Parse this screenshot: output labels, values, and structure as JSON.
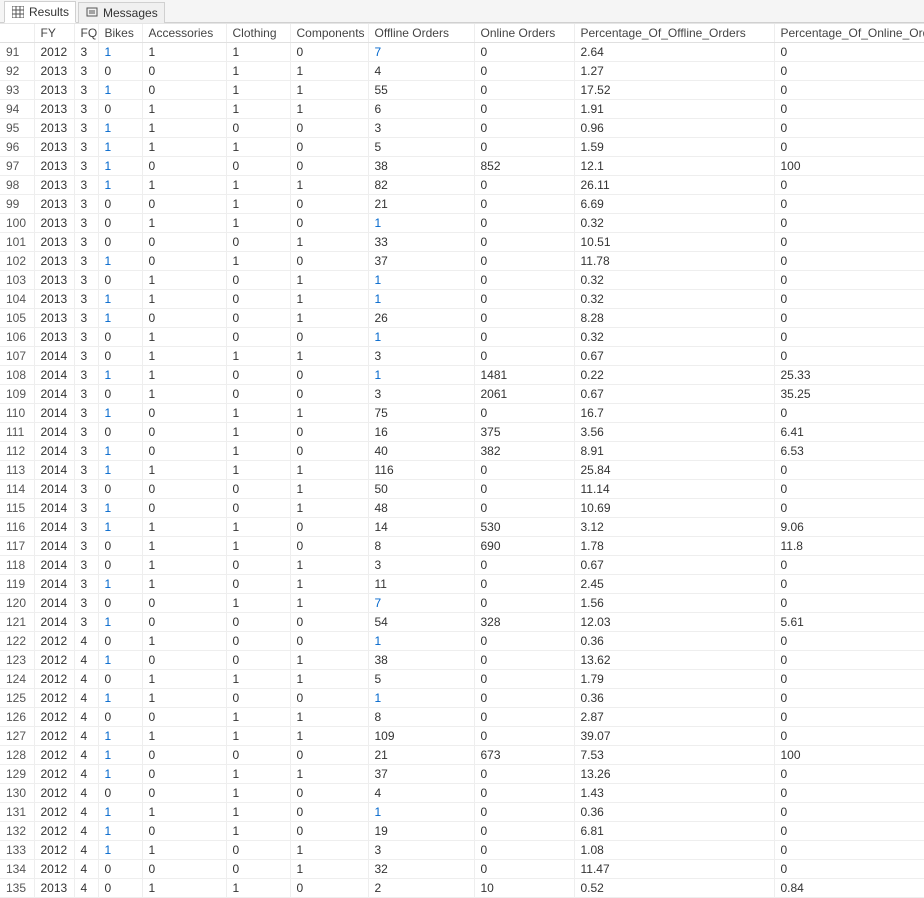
{
  "tabs": {
    "results": "Results",
    "messages": "Messages"
  },
  "columns": [
    "",
    "FY",
    "FQ",
    "Bikes",
    "Accessories",
    "Clothing",
    "Components",
    "Offline Orders",
    "Online Orders",
    "Percentage_Of_Offline_Orders",
    "Percentage_Of_Online_Orders"
  ],
  "link_columns": {
    "3": true,
    "7": true
  },
  "rows": [
    {
      "n": "91",
      "FY": "2012",
      "FQ": "3",
      "Bikes": "1",
      "Accessories": "1",
      "Clothing": "1",
      "Components": "0",
      "Offline": "7",
      "Online": "0",
      "PctOff": "2.64",
      "PctOn": "0"
    },
    {
      "n": "92",
      "FY": "2013",
      "FQ": "3",
      "Bikes": "0",
      "Accessories": "0",
      "Clothing": "1",
      "Components": "1",
      "Offline": "4",
      "Online": "0",
      "PctOff": "1.27",
      "PctOn": "0"
    },
    {
      "n": "93",
      "FY": "2013",
      "FQ": "3",
      "Bikes": "1",
      "Accessories": "0",
      "Clothing": "1",
      "Components": "1",
      "Offline": "55",
      "Online": "0",
      "PctOff": "17.52",
      "PctOn": "0"
    },
    {
      "n": "94",
      "FY": "2013",
      "FQ": "3",
      "Bikes": "0",
      "Accessories": "1",
      "Clothing": "1",
      "Components": "1",
      "Offline": "6",
      "Online": "0",
      "PctOff": "1.91",
      "PctOn": "0"
    },
    {
      "n": "95",
      "FY": "2013",
      "FQ": "3",
      "Bikes": "1",
      "Accessories": "1",
      "Clothing": "0",
      "Components": "0",
      "Offline": "3",
      "Online": "0",
      "PctOff": "0.96",
      "PctOn": "0"
    },
    {
      "n": "96",
      "FY": "2013",
      "FQ": "3",
      "Bikes": "1",
      "Accessories": "1",
      "Clothing": "1",
      "Components": "0",
      "Offline": "5",
      "Online": "0",
      "PctOff": "1.59",
      "PctOn": "0"
    },
    {
      "n": "97",
      "FY": "2013",
      "FQ": "3",
      "Bikes": "1",
      "Accessories": "0",
      "Clothing": "0",
      "Components": "0",
      "Offline": "38",
      "Online": "852",
      "PctOff": "12.1",
      "PctOn": "100"
    },
    {
      "n": "98",
      "FY": "2013",
      "FQ": "3",
      "Bikes": "1",
      "Accessories": "1",
      "Clothing": "1",
      "Components": "1",
      "Offline": "82",
      "Online": "0",
      "PctOff": "26.11",
      "PctOn": "0"
    },
    {
      "n": "99",
      "FY": "2013",
      "FQ": "3",
      "Bikes": "0",
      "Accessories": "0",
      "Clothing": "1",
      "Components": "0",
      "Offline": "21",
      "Online": "0",
      "PctOff": "6.69",
      "PctOn": "0"
    },
    {
      "n": "100",
      "FY": "2013",
      "FQ": "3",
      "Bikes": "0",
      "Accessories": "1",
      "Clothing": "1",
      "Components": "0",
      "Offline": "1",
      "Online": "0",
      "PctOff": "0.32",
      "PctOn": "0"
    },
    {
      "n": "101",
      "FY": "2013",
      "FQ": "3",
      "Bikes": "0",
      "Accessories": "0",
      "Clothing": "0",
      "Components": "1",
      "Offline": "33",
      "Online": "0",
      "PctOff": "10.51",
      "PctOn": "0"
    },
    {
      "n": "102",
      "FY": "2013",
      "FQ": "3",
      "Bikes": "1",
      "Accessories": "0",
      "Clothing": "1",
      "Components": "0",
      "Offline": "37",
      "Online": "0",
      "PctOff": "11.78",
      "PctOn": "0"
    },
    {
      "n": "103",
      "FY": "2013",
      "FQ": "3",
      "Bikes": "0",
      "Accessories": "1",
      "Clothing": "0",
      "Components": "1",
      "Offline": "1",
      "Online": "0",
      "PctOff": "0.32",
      "PctOn": "0"
    },
    {
      "n": "104",
      "FY": "2013",
      "FQ": "3",
      "Bikes": "1",
      "Accessories": "1",
      "Clothing": "0",
      "Components": "1",
      "Offline": "1",
      "Online": "0",
      "PctOff": "0.32",
      "PctOn": "0"
    },
    {
      "n": "105",
      "FY": "2013",
      "FQ": "3",
      "Bikes": "1",
      "Accessories": "0",
      "Clothing": "0",
      "Components": "1",
      "Offline": "26",
      "Online": "0",
      "PctOff": "8.28",
      "PctOn": "0"
    },
    {
      "n": "106",
      "FY": "2013",
      "FQ": "3",
      "Bikes": "0",
      "Accessories": "1",
      "Clothing": "0",
      "Components": "0",
      "Offline": "1",
      "Online": "0",
      "PctOff": "0.32",
      "PctOn": "0"
    },
    {
      "n": "107",
      "FY": "2014",
      "FQ": "3",
      "Bikes": "0",
      "Accessories": "1",
      "Clothing": "1",
      "Components": "1",
      "Offline": "3",
      "Online": "0",
      "PctOff": "0.67",
      "PctOn": "0"
    },
    {
      "n": "108",
      "FY": "2014",
      "FQ": "3",
      "Bikes": "1",
      "Accessories": "1",
      "Clothing": "0",
      "Components": "0",
      "Offline": "1",
      "Online": "1481",
      "PctOff": "0.22",
      "PctOn": "25.33"
    },
    {
      "n": "109",
      "FY": "2014",
      "FQ": "3",
      "Bikes": "0",
      "Accessories": "1",
      "Clothing": "0",
      "Components": "0",
      "Offline": "3",
      "Online": "2061",
      "PctOff": "0.67",
      "PctOn": "35.25"
    },
    {
      "n": "110",
      "FY": "2014",
      "FQ": "3",
      "Bikes": "1",
      "Accessories": "0",
      "Clothing": "1",
      "Components": "1",
      "Offline": "75",
      "Online": "0",
      "PctOff": "16.7",
      "PctOn": "0"
    },
    {
      "n": "111",
      "FY": "2014",
      "FQ": "3",
      "Bikes": "0",
      "Accessories": "0",
      "Clothing": "1",
      "Components": "0",
      "Offline": "16",
      "Online": "375",
      "PctOff": "3.56",
      "PctOn": "6.41"
    },
    {
      "n": "112",
      "FY": "2014",
      "FQ": "3",
      "Bikes": "1",
      "Accessories": "0",
      "Clothing": "1",
      "Components": "0",
      "Offline": "40",
      "Online": "382",
      "PctOff": "8.91",
      "PctOn": "6.53"
    },
    {
      "n": "113",
      "FY": "2014",
      "FQ": "3",
      "Bikes": "1",
      "Accessories": "1",
      "Clothing": "1",
      "Components": "1",
      "Offline": "116",
      "Online": "0",
      "PctOff": "25.84",
      "PctOn": "0"
    },
    {
      "n": "114",
      "FY": "2014",
      "FQ": "3",
      "Bikes": "0",
      "Accessories": "0",
      "Clothing": "0",
      "Components": "1",
      "Offline": "50",
      "Online": "0",
      "PctOff": "11.14",
      "PctOn": "0"
    },
    {
      "n": "115",
      "FY": "2014",
      "FQ": "3",
      "Bikes": "1",
      "Accessories": "0",
      "Clothing": "0",
      "Components": "1",
      "Offline": "48",
      "Online": "0",
      "PctOff": "10.69",
      "PctOn": "0"
    },
    {
      "n": "116",
      "FY": "2014",
      "FQ": "3",
      "Bikes": "1",
      "Accessories": "1",
      "Clothing": "1",
      "Components": "0",
      "Offline": "14",
      "Online": "530",
      "PctOff": "3.12",
      "PctOn": "9.06"
    },
    {
      "n": "117",
      "FY": "2014",
      "FQ": "3",
      "Bikes": "0",
      "Accessories": "1",
      "Clothing": "1",
      "Components": "0",
      "Offline": "8",
      "Online": "690",
      "PctOff": "1.78",
      "PctOn": "11.8"
    },
    {
      "n": "118",
      "FY": "2014",
      "FQ": "3",
      "Bikes": "0",
      "Accessories": "1",
      "Clothing": "0",
      "Components": "1",
      "Offline": "3",
      "Online": "0",
      "PctOff": "0.67",
      "PctOn": "0"
    },
    {
      "n": "119",
      "FY": "2014",
      "FQ": "3",
      "Bikes": "1",
      "Accessories": "1",
      "Clothing": "0",
      "Components": "1",
      "Offline": "11",
      "Online": "0",
      "PctOff": "2.45",
      "PctOn": "0"
    },
    {
      "n": "120",
      "FY": "2014",
      "FQ": "3",
      "Bikes": "0",
      "Accessories": "0",
      "Clothing": "1",
      "Components": "1",
      "Offline": "7",
      "Online": "0",
      "PctOff": "1.56",
      "PctOn": "0"
    },
    {
      "n": "121",
      "FY": "2014",
      "FQ": "3",
      "Bikes": "1",
      "Accessories": "0",
      "Clothing": "0",
      "Components": "0",
      "Offline": "54",
      "Online": "328",
      "PctOff": "12.03",
      "PctOn": "5.61"
    },
    {
      "n": "122",
      "FY": "2012",
      "FQ": "4",
      "Bikes": "0",
      "Accessories": "1",
      "Clothing": "0",
      "Components": "0",
      "Offline": "1",
      "Online": "0",
      "PctOff": "0.36",
      "PctOn": "0"
    },
    {
      "n": "123",
      "FY": "2012",
      "FQ": "4",
      "Bikes": "1",
      "Accessories": "0",
      "Clothing": "0",
      "Components": "1",
      "Offline": "38",
      "Online": "0",
      "PctOff": "13.62",
      "PctOn": "0"
    },
    {
      "n": "124",
      "FY": "2012",
      "FQ": "4",
      "Bikes": "0",
      "Accessories": "1",
      "Clothing": "1",
      "Components": "1",
      "Offline": "5",
      "Online": "0",
      "PctOff": "1.79",
      "PctOn": "0"
    },
    {
      "n": "125",
      "FY": "2012",
      "FQ": "4",
      "Bikes": "1",
      "Accessories": "1",
      "Clothing": "0",
      "Components": "0",
      "Offline": "1",
      "Online": "0",
      "PctOff": "0.36",
      "PctOn": "0"
    },
    {
      "n": "126",
      "FY": "2012",
      "FQ": "4",
      "Bikes": "0",
      "Accessories": "0",
      "Clothing": "1",
      "Components": "1",
      "Offline": "8",
      "Online": "0",
      "PctOff": "2.87",
      "PctOn": "0"
    },
    {
      "n": "127",
      "FY": "2012",
      "FQ": "4",
      "Bikes": "1",
      "Accessories": "1",
      "Clothing": "1",
      "Components": "1",
      "Offline": "109",
      "Online": "0",
      "PctOff": "39.07",
      "PctOn": "0"
    },
    {
      "n": "128",
      "FY": "2012",
      "FQ": "4",
      "Bikes": "1",
      "Accessories": "0",
      "Clothing": "0",
      "Components": "0",
      "Offline": "21",
      "Online": "673",
      "PctOff": "7.53",
      "PctOn": "100"
    },
    {
      "n": "129",
      "FY": "2012",
      "FQ": "4",
      "Bikes": "1",
      "Accessories": "0",
      "Clothing": "1",
      "Components": "1",
      "Offline": "37",
      "Online": "0",
      "PctOff": "13.26",
      "PctOn": "0"
    },
    {
      "n": "130",
      "FY": "2012",
      "FQ": "4",
      "Bikes": "0",
      "Accessories": "0",
      "Clothing": "1",
      "Components": "0",
      "Offline": "4",
      "Online": "0",
      "PctOff": "1.43",
      "PctOn": "0"
    },
    {
      "n": "131",
      "FY": "2012",
      "FQ": "4",
      "Bikes": "1",
      "Accessories": "1",
      "Clothing": "1",
      "Components": "0",
      "Offline": "1",
      "Online": "0",
      "PctOff": "0.36",
      "PctOn": "0"
    },
    {
      "n": "132",
      "FY": "2012",
      "FQ": "4",
      "Bikes": "1",
      "Accessories": "0",
      "Clothing": "1",
      "Components": "0",
      "Offline": "19",
      "Online": "0",
      "PctOff": "6.81",
      "PctOn": "0"
    },
    {
      "n": "133",
      "FY": "2012",
      "FQ": "4",
      "Bikes": "1",
      "Accessories": "1",
      "Clothing": "0",
      "Components": "1",
      "Offline": "3",
      "Online": "0",
      "PctOff": "1.08",
      "PctOn": "0"
    },
    {
      "n": "134",
      "FY": "2012",
      "FQ": "4",
      "Bikes": "0",
      "Accessories": "0",
      "Clothing": "0",
      "Components": "1",
      "Offline": "32",
      "Online": "0",
      "PctOff": "11.47",
      "PctOn": "0"
    },
    {
      "n": "135",
      "FY": "2013",
      "FQ": "4",
      "Bikes": "0",
      "Accessories": "1",
      "Clothing": "1",
      "Components": "0",
      "Offline": "2",
      "Online": "10",
      "PctOff": "0.52",
      "PctOn": "0.84"
    }
  ]
}
